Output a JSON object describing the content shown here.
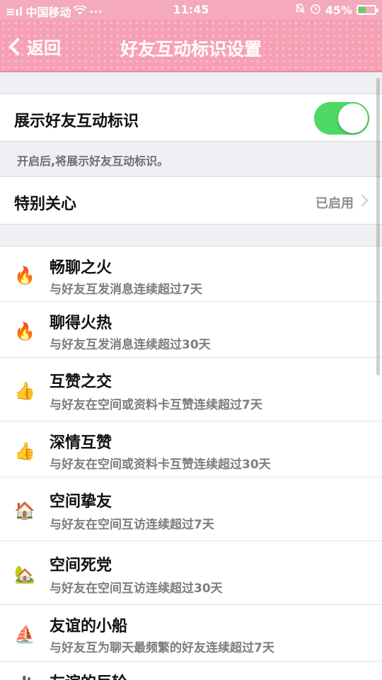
{
  "status_bar": {
    "carrier": "中国移动",
    "signal": "≡ıl",
    "extra": "···",
    "time": "11:45",
    "battery_text": "45%",
    "battery_level": 0.45
  },
  "nav": {
    "back_label": "返回",
    "title": "好友互动标识设置"
  },
  "settings": {
    "show_badges_label": "展示好友互动标识",
    "show_badges_on": true,
    "note": "开启后,将展示好友互动标识。",
    "special_care_label": "特别关心",
    "special_care_value": "已启用"
  },
  "badges": [
    {
      "icon": "small-flame-icon",
      "glyph": "🔥",
      "name": "畅聊之火",
      "desc": "与好友互发消息连续超过7天"
    },
    {
      "icon": "big-flame-icon",
      "glyph": "🔥",
      "name": "聊得火热",
      "desc": "与好友互发消息连续超过30天"
    },
    {
      "icon": "thumbs-up-icon",
      "glyph": "👍",
      "name": "互赞之交",
      "desc": "与好友在空间或资料卡互赞连续超过7天"
    },
    {
      "icon": "thumbs-up-heart-icon",
      "glyph": "👍",
      "name": "深情互赞",
      "desc": "与好友在空间或资料卡互赞连续超过30天"
    },
    {
      "icon": "house-icon",
      "glyph": "🏠",
      "name": "空间挚友",
      "desc": "与好友在空间互访连续超过7天"
    },
    {
      "icon": "house-sun-icon",
      "glyph": "🏡",
      "name": "空间死党",
      "desc": "与好友在空间互访连续超过30天"
    },
    {
      "icon": "sailboat-icon",
      "glyph": "⛵",
      "name": "友谊的小船",
      "desc": "与好友互为聊天最频繁的好友连续超过7天"
    },
    {
      "icon": "ship-icon",
      "glyph": "🚢",
      "name": "友谊的巨轮",
      "desc": ""
    }
  ]
}
